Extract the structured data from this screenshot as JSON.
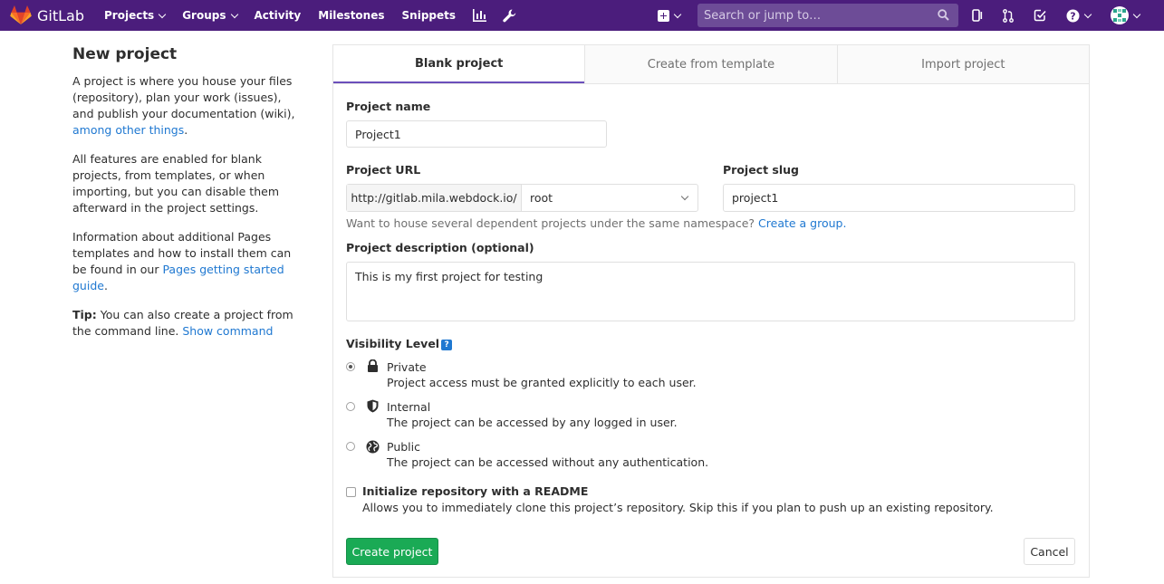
{
  "navbar": {
    "brand": "GitLab",
    "links": [
      "Projects",
      "Groups",
      "Activity",
      "Milestones",
      "Snippets"
    ],
    "search_placeholder": "Search or jump to…"
  },
  "sidebar": {
    "title": "New project",
    "p1_text": "A project is where you house your files (repository), plan your work (issues), and publish your documentation (wiki), ",
    "p1_link": "among other things",
    "p1_end": ".",
    "p2_text": "All features are enabled for blank projects, from templates, or when importing, but you can disable them afterward in the project settings.",
    "p3_text": "Information about additional Pages templates and how to install them can be found in our ",
    "p3_link": "Pages getting started guide",
    "p3_end": ".",
    "p4_bold": "Tip:",
    "p4_text": " You can also create a project from the command line. ",
    "p4_link": "Show command"
  },
  "tabs": [
    "Blank project",
    "Create from template",
    "Import project"
  ],
  "form": {
    "project_name_label": "Project name",
    "project_name_value": "Project1",
    "project_url_label": "Project URL",
    "url_prefix": "http://gitlab.mila.webdock.io/",
    "namespace": "root",
    "project_slug_label": "Project slug",
    "project_slug_value": "project1",
    "group_help": "Want to house several dependent projects under the same namespace? ",
    "group_link": "Create a group.",
    "description_label": "Project description (optional)",
    "description_value": "This is my first project for testing",
    "visibility_label": "Visibility Level",
    "visibility_help": "?",
    "options": [
      {
        "title": "Private",
        "desc": "Project access must be granted explicitly to each user."
      },
      {
        "title": "Internal",
        "desc": "The project can be accessed by any logged in user."
      },
      {
        "title": "Public",
        "desc": "The project can be accessed without any authentication."
      }
    ],
    "readme_label": "Initialize repository with a README",
    "readme_desc": "Allows you to immediately clone this project’s repository. Skip this if you plan to push up an existing repository.",
    "create_button": "Create project",
    "cancel_button": "Cancel"
  }
}
